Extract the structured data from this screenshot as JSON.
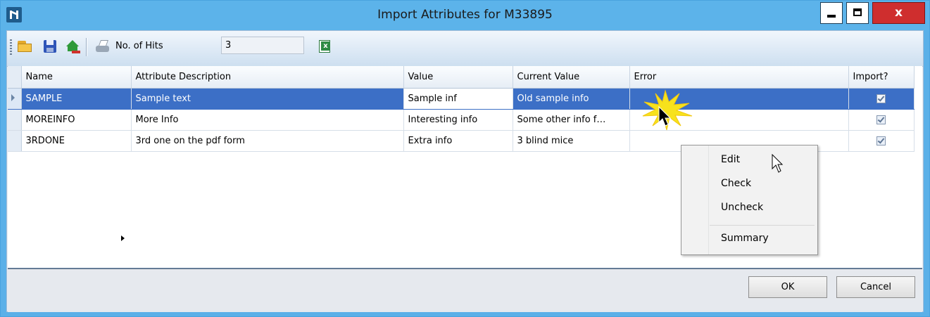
{
  "window": {
    "title": "Import Attributes for M33895",
    "close_glyph": "x"
  },
  "toolbar": {
    "hits_label": "No. of Hits",
    "hits_value": "3",
    "icons": [
      "folder-open-icon",
      "save-icon",
      "revert-icon",
      "print-icon",
      "excel-export-icon"
    ]
  },
  "grid": {
    "columns": [
      "Name",
      "Attribute Description",
      "Value",
      "Current Value",
      "Error",
      "Import?"
    ],
    "rows": [
      {
        "name": "SAMPLE",
        "description": "Sample text",
        "value": "Sample inf",
        "current": "Old sample info",
        "error": "",
        "import": true,
        "selected": true
      },
      {
        "name": "MOREINFO",
        "description": "More Info",
        "value": "Interesting info",
        "current": "Some other info f…",
        "error": "",
        "import": true,
        "selected": false
      },
      {
        "name": "3RDONE",
        "description": "3rd one on the pdf form",
        "value": "Extra info",
        "current": "3 blind mice",
        "error": "",
        "import": true,
        "selected": false
      }
    ]
  },
  "context_menu": {
    "items": [
      "Edit",
      "Check",
      "Uncheck"
    ],
    "submenu_item": "Summary"
  },
  "footer": {
    "ok_label": "OK",
    "cancel_label": "Cancel"
  },
  "colors": {
    "title_bar": "#5cb3ea",
    "selection": "#3c6fc6",
    "close_button": "#cf2e2e",
    "click_highlight": "#f7e21c"
  }
}
